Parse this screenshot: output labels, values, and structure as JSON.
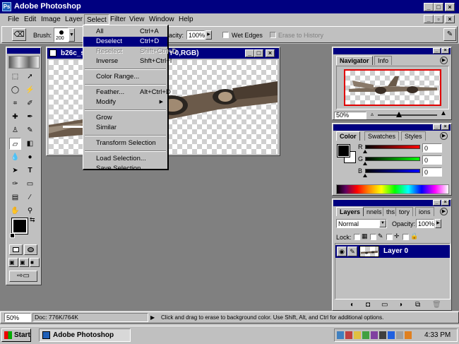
{
  "app": {
    "title": "Adobe Photoshop"
  },
  "menu": [
    "File",
    "Edit",
    "Image",
    "Layer",
    "Select",
    "Filter",
    "View",
    "Window",
    "Help"
  ],
  "options_bar": {
    "brush_label": "Brush:",
    "brush_size": "200",
    "opacity_label": "acity:",
    "opacity_value": "100%",
    "wet_edges": "Wet Edges",
    "erase_to_history": "Erase to History"
  },
  "select_menu": [
    {
      "label": "All",
      "shortcut": "Ctrl+A",
      "state": "normal"
    },
    {
      "label": "Deselect",
      "shortcut": "Ctrl+D",
      "state": "highlighted"
    },
    {
      "label": "Reselect",
      "shortcut": "Shift+Ctrl+D",
      "state": "disabled"
    },
    {
      "label": "Inverse",
      "shortcut": "Shft+Ctrl+I",
      "state": "normal"
    },
    {
      "sep": true
    },
    {
      "label": "Color Range...",
      "state": "normal"
    },
    {
      "sep": true
    },
    {
      "label": "Feather...",
      "shortcut": "Alt+Ctrl+D",
      "state": "normal"
    },
    {
      "label": "Modify",
      "submenu": true,
      "state": "normal"
    },
    {
      "sep": true
    },
    {
      "label": "Grow",
      "state": "normal"
    },
    {
      "label": "Similar",
      "state": "normal"
    },
    {
      "sep": true
    },
    {
      "label": "Transform Selection",
      "state": "normal"
    },
    {
      "sep": true
    },
    {
      "label": "Load Selection...",
      "state": "normal"
    },
    {
      "label": "Save Selection...",
      "state": "normal"
    }
  ],
  "document": {
    "title_left": "b26c_s",
    "title_right": "r 0,RGB)"
  },
  "navigator": {
    "tabs": [
      "Navigator",
      "Info"
    ],
    "zoom": "50%"
  },
  "color_panel": {
    "tabs": [
      "Color",
      "Swatches",
      "Styles"
    ],
    "channels": [
      {
        "label": "R",
        "value": "0",
        "gradient": "#ff0000"
      },
      {
        "label": "G",
        "value": "0",
        "gradient": "#00ff00"
      },
      {
        "label": "B",
        "value": "0",
        "gradient": "#0000ff"
      }
    ]
  },
  "layers_panel": {
    "tabs": [
      "Layers",
      "nnels",
      "ths",
      "tory",
      "ions"
    ],
    "blend_mode": "Normal",
    "opacity_label": "Opacity:",
    "opacity_value": "100%",
    "lock_label": "Lock:",
    "layer_name": "Layer 0"
  },
  "status_bar": {
    "zoom": "50%",
    "doc": "Doc: 776K/764K",
    "hint": "Click and drag to erase to background color.  Use Shift, Alt, and Ctrl for additional options."
  },
  "taskbar": {
    "start": "Start",
    "task": "Adobe Photoshop",
    "time": "4:33 PM"
  },
  "colors": {
    "title_blue": "#000080",
    "desktop_gray": "#808080",
    "face": "#c0c0c0"
  }
}
